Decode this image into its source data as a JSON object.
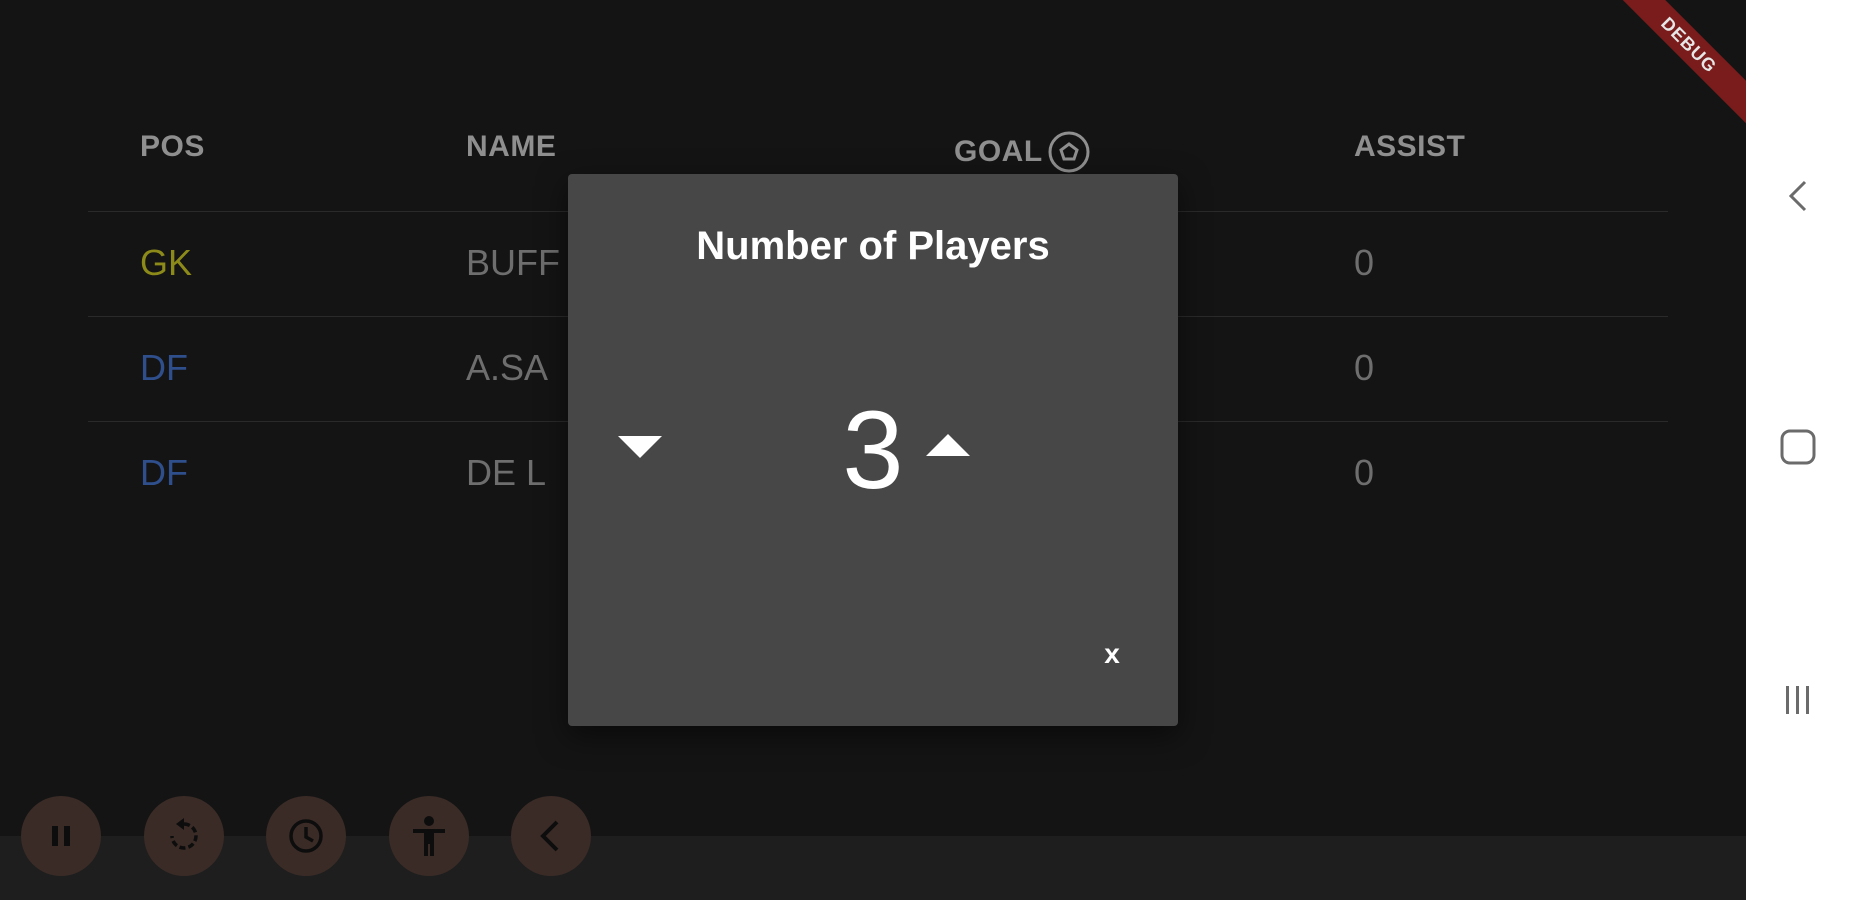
{
  "table": {
    "headers": {
      "pos": "POS",
      "name": "NAME",
      "goal": "GOAL",
      "assist": "ASSIST"
    },
    "rows": [
      {
        "pos": "GK",
        "name": "BUFF",
        "assist": "0"
      },
      {
        "pos": "DF",
        "name": "A.SA",
        "assist": "0"
      },
      {
        "pos": "DF",
        "name": "DE L",
        "assist": "0"
      }
    ]
  },
  "banner": {
    "label": "DEBUG"
  },
  "dialog": {
    "title": "Number of Players",
    "value": "3",
    "close_label": "x",
    "icons": {
      "decrement": "triangle-down-icon",
      "increment": "triangle-up-icon"
    }
  },
  "toolbar": {
    "icons": [
      "pause-icon",
      "replay-icon",
      "clock-icon",
      "accessibility-icon",
      "chevron-left-icon"
    ]
  },
  "system_nav": {
    "icons": [
      "back-chevron-icon",
      "home-square-icon",
      "recents-bars-icon"
    ]
  },
  "colors": {
    "background": "#141414",
    "dialog": "#474747",
    "gk": "#8c8a19",
    "df": "#2f4f8c",
    "fab": "#3a2b26",
    "debug": "#7a1c1c"
  }
}
